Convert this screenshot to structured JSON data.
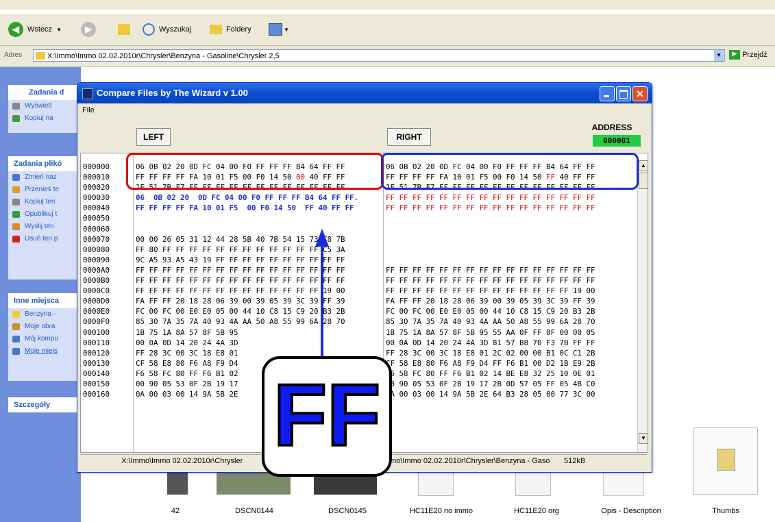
{
  "explorer": {
    "back_label": "Wstecz",
    "search_label": "Wyszukaj",
    "folders_label": "Foldery",
    "address_label": "Adres",
    "address_value": "X:\\Immo\\Immo 02.02.2010r\\Chrysler\\Benzyna - Gasoline\\Chrysler 2,5",
    "go_label": "Przejdź",
    "taskpane": {
      "box1_title": "Zadania d",
      "box1_items": [
        "Wyświetl",
        "Kopiuj na"
      ],
      "box2_title": "Zadania plikó",
      "box2_items": [
        "Zmień naz",
        "Przenieś te",
        "Kopiuj ten",
        "Opublikuj t",
        "Wyślij ten",
        "Usuń ten p"
      ],
      "box3_title": "Inne miejsca",
      "box3_items": [
        "Benzyna -",
        "Moje obra",
        "Mój kompu",
        "Moje miejs"
      ],
      "box4_title": "Szczegóły"
    },
    "files": [
      "42",
      "DSCN0144",
      "DSCN0145",
      "HC11E20 no immo",
      "HC11E20 org",
      "Opis - Description",
      "Thumbs"
    ]
  },
  "wizard": {
    "title": "Compare Files by The Wizard   v 1.00",
    "menu_file": "File",
    "left_button": "LEFT",
    "right_button": "RIGHT",
    "address_label": "ADDRESS",
    "address_value": "000001",
    "status_left": "X:\\Immo\\Immo 02.02.2010r\\Chrysler",
    "status_right": "mo\\Immo 02.02.2010r\\Chrysler\\Benzyna - Gaso",
    "status_size": "512kB",
    "offsets": [
      "000000",
      "000010",
      "000020",
      "000030",
      "000040",
      "000050",
      "000060",
      "000070",
      "000080",
      "000090",
      "0000A0",
      "0000B0",
      "0000C0",
      "0000D0",
      "0000E0",
      "0000F0",
      "000100",
      "000110",
      "000120",
      "000130",
      "000140",
      "000150",
      "000160"
    ],
    "left_rows": [
      "06 0B 02 20 0D FC 04 00 F0 FF FF FF B4 64 FF FF",
      "FF FF FF FF FA 10 01 F5 00 F0 14 50 |00| 40 FF FF",
      "1E 51 7B F7 FF FF FF FF FF FF FF FF FF FF FF FF",
      "06  0B 02 20  0D FC 04 00 F0 FF FF FF B4 64 FF FF.",
      "FF FF FF FF FA 10 01 F5  00 F0 14 50  FF 40 FF FF",
      "",
      "",
      "00 00 26 05 31 12 44 28 5B 40 7B 54 15 73 C8 7B",
      "FF 80 FF FF FF FF FF FF FF FF FF FF FF FF C5 3A",
      "9C A5 93 A5 43 19 FF FF FF FF FF FF FF FF FF FF",
      "FF FF FF FF FF FF FF FF FF FF FF FF FF FF FF FF",
      "FF FF FF FF FF FF FF FF FF FF FF FF FF FF FF FF",
      "FF FF FF FF FF FF FF FF FF FF FF FF FF FF 19 00",
      "FA FF FF 20 18 28 06 39 00 39 05 39 3C 39 FF 39",
      "FC 00 FC 00 E0 E0 05 00 44 10 C8 15 C9 20 B3 2B",
      "85 30 7A 35 7A 40 93 4A AA 50 A8 55 99 6A 28 70",
      "1B 75 1A 8A 57 8F 5B 95",
      "00 0A 0D 14 20 24 4A 3D",
      "FF 28 3C 00 3C 18 E8 01",
      "CF 58 E8 80 F6 A8 F9 D4",
      "F6 58 FC 80 FF F6 B1 02",
      "00 90 05 53 0F 2B 19 17",
      "0A 00 03 00 14 9A 5B 2E"
    ],
    "right_rows": [
      "06 0B 02 20 0D FC 04 00 F0 FF FF FF B4 64 FF FF",
      "FF FF FF FF FA 10 01 F5 00 F0 14 50 |FF| 40 FF FF",
      "1E 51 7B F7 FF FF FF FF FF FF FF FF FF FF FF FF",
      "FF FF FF FF FF FF FF FF FF FF FF FF FF FF FF FF",
      "FF FF FF FF FF FF FF FF FF FF FF FF FF FF FF FF",
      "",
      "",
      "",
      "",
      "",
      "FF FF FF FF FF FF FF FF FF FF FF FF FF FF FF FF",
      "FF FF FF FF FF FF FF FF FF FF FF FF FF FF FF FF",
      "FF FF FF FF FF FF FF FF FF FF FF FF FF FF 19 00",
      "FA FF FF 20 18 28 06 39 00 39 05 39 3C 39 FF 39",
      "FC 00 FC 00 E0 E0 05 00 44 10 C8 15 C9 20 B3 2B",
      "85 30 7A 35 7A 40 93 4A AA 50 A8 55 99 6A 28 70",
      "1B 75 1A 8A 57 8F 5B 95 55 AA 0F FF 0F 00 00 05",
      "00 0A 0D 14 20 24 4A 3D 81 57 B8 70 F3 7B FF FF",
      "FF 28 3C 00 3C 18 E8 01 2C 02 00 00 B1 0C C1 2B",
      "CF 58 E8 80 F6 A8 F9 D4 FF F6 B1 00 D2 1B E9 2B",
      "F6 58 FC 80 FF F6 B1 02 14 BE E8 32 25 10 0E 01",
      "00 90 05 53 0F 2B 19 17 2B 0D 57 05 FF 05 4B C0",
      "0A 00 03 00 14 9A 5B 2E 64 B3 28 05 00 77 3C 00"
    ],
    "callout_text": "FF"
  },
  "colors": {
    "diff": "#e00000",
    "highlight_blue": "#1a2bd6",
    "address_bg": "#22cc44"
  }
}
